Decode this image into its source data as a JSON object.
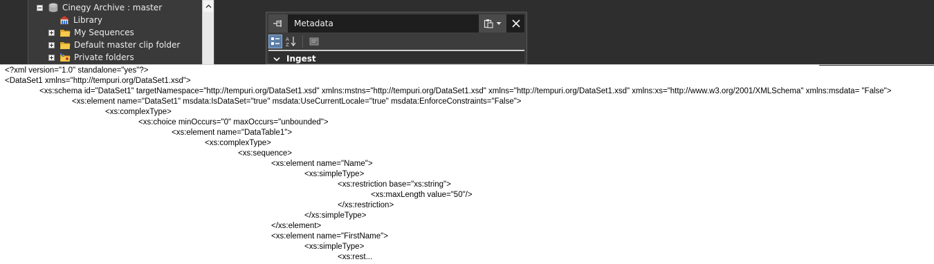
{
  "archive_tree": {
    "items": [
      {
        "label": "Cinegy Archive : master",
        "icon": "database-icon",
        "expander": "collapse"
      },
      {
        "label": "Library",
        "icon": "library-icon",
        "expander": "none"
      },
      {
        "label": "My Sequences",
        "icon": "folder-icon",
        "expander": "expand"
      },
      {
        "label": "Default master clip folder",
        "icon": "folder-icon",
        "expander": "expand"
      },
      {
        "label": "Private folders",
        "icon": "private-folder-icon",
        "expander": "expand"
      }
    ]
  },
  "metadata_panel": {
    "title": "Metadata",
    "section": "Ingest"
  },
  "xml_document": {
    "lines": [
      "<?xml version=\"1.0\" standalone=\"yes\"?>",
      "<DataSet1 xmlns=\"http://tempuri.org/DataSet1.xsd\">",
      "<xs:schema id=\"DataSet1\" targetNamespace=\"http://tempuri.org/DataSet1.xsd\" xmlns:mstns=\"http://tempuri.org/DataSet1.xsd\" xmlns=\"http://tempuri.org/DataSet1.xsd\" xmlns:xs=\"http://www.w3.org/2001/XMLSchema\" xmlns:msdata= \"False\">",
      "<xs:element name=\"DataSet1\" msdata:IsDataSet=\"true\" msdata:UseCurrentLocale=\"true\" msdata:EnforceConstraints=\"False\">",
      "<xs:complexType>",
      "<xs:choice minOccurs=\"0\" maxOccurs=\"unbounded\">",
      "<xs:element name=\"DataTable1\">",
      "<xs:complexType>",
      "<xs:sequence>",
      "<xs:element name=\"Name\">",
      "<xs:simpleType>",
      "<xs:restriction base=\"xs:string\">",
      "<xs:maxLength value=\"50\"/>",
      "</xs:restriction>",
      "</xs:simpleType>",
      "</xs:element>",
      "<xs:element name=\"FirstName\">",
      "<xs:simpleType>",
      "<xs:rest..."
    ]
  }
}
